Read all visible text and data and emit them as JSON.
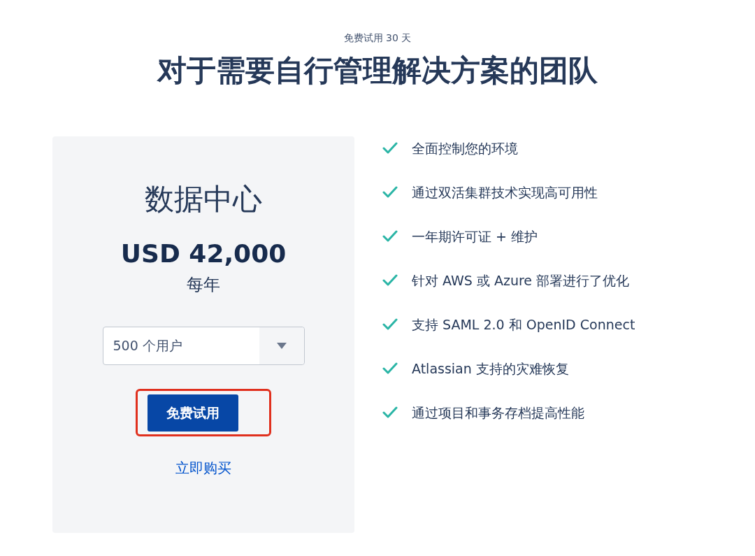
{
  "eyebrow": "免费试用 30 天",
  "title": "对于需要自行管理解决方案的团队",
  "plan": {
    "name": "数据中心",
    "price": "USD 42,000",
    "period": "每年",
    "user_select": {
      "value": "500 个用户"
    },
    "trial_button": "免费试用",
    "buy_link": "立即购买"
  },
  "features": [
    {
      "text": "全面控制您的环境"
    },
    {
      "text": "通过双活集群技术实现高可用性"
    },
    {
      "text": "一年期许可证 + 维护"
    },
    {
      "text": "针对 AWS 或 Azure 部署进行了优化"
    },
    {
      "text": "支持 SAML 2.0 和 OpenID Connect"
    },
    {
      "text": "Atlassian 支持的灾难恢复"
    },
    {
      "text": "通过项目和事务存档提高性能"
    }
  ]
}
